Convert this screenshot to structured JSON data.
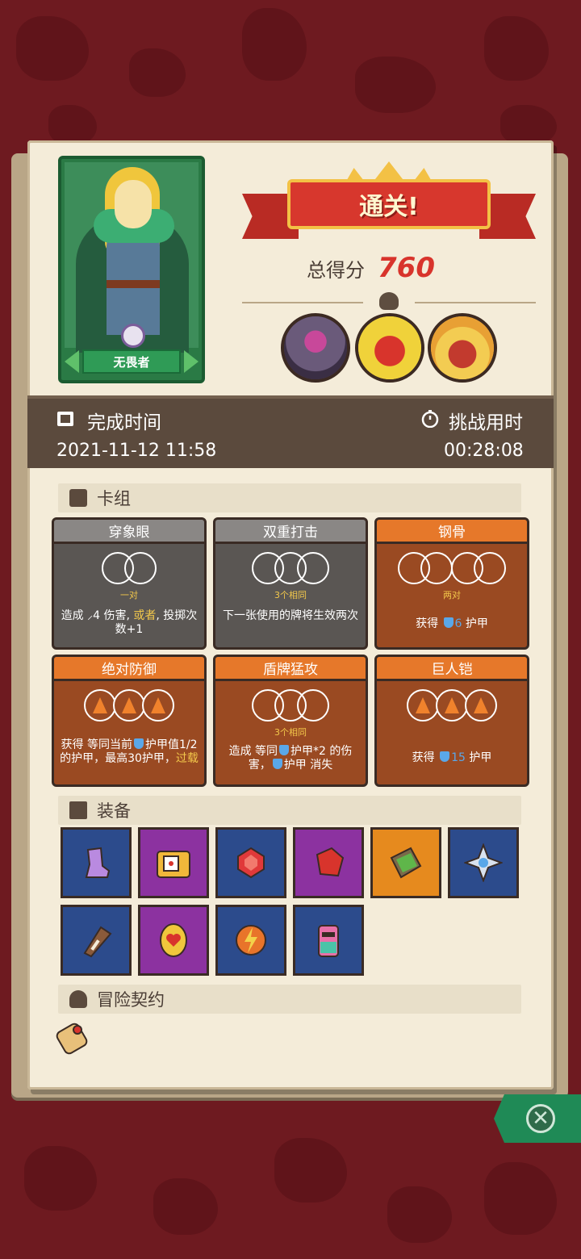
{
  "hero": {
    "name": "无畏者"
  },
  "banner": {
    "title": "通关!"
  },
  "score": {
    "label": "总得分",
    "value": "760"
  },
  "time": {
    "finish_label": "完成时间",
    "finish_value": "2021-11-12 11:58",
    "duration_label": "挑战用时",
    "duration_value": "00:28:08"
  },
  "sections": {
    "deck": "卡组",
    "equipment": "装备",
    "contract": "冒险契约"
  },
  "skills": [
    {
      "name": "穿象眼",
      "dice_label": "一对",
      "desc_a": "造成 ",
      "desc_b": "4 伤害, ",
      "desc_hl": "或者",
      "desc_c": ", 投掷次数+1"
    },
    {
      "name": "双重打击",
      "dice_label": "3个相同",
      "desc": "下一张使用的牌将生效两次"
    },
    {
      "name": "钢骨",
      "dice_label": "两对",
      "desc_a": "获得 ",
      "desc_value": "6",
      "desc_b": " 护甲"
    },
    {
      "name": "绝对防御",
      "desc_a": "获得 等同当前",
      "desc_b": "护甲值1/2的护甲，最高30护甲，",
      "desc_hl": "过载"
    },
    {
      "name": "盾牌猛攻",
      "dice_label": "3个相同",
      "desc_a": "造成 等同",
      "desc_b": "护甲*2 的伤害，",
      "desc_c": "护甲 消失"
    },
    {
      "name": "巨人铠",
      "desc_a": "获得 ",
      "desc_value": "15",
      "desc_b": " 护甲"
    }
  ],
  "equipment": [
    {
      "icon": "crystal-boot-icon",
      "bg": "#2c4b8c"
    },
    {
      "icon": "dice-chest-icon",
      "bg": "#8c32a0"
    },
    {
      "icon": "red-gem-icon",
      "bg": "#2c4b8c"
    },
    {
      "icon": "ruby-icon",
      "bg": "#8c32a0"
    },
    {
      "icon": "moss-stone-icon",
      "bg": "#e68a1e"
    },
    {
      "icon": "silver-cross-icon",
      "bg": "#2c4b8c"
    },
    {
      "icon": "horn-icon",
      "bg": "#2c4b8c"
    },
    {
      "icon": "heart-rune-icon",
      "bg": "#8c32a0"
    },
    {
      "icon": "lightning-orb-icon",
      "bg": "#2c4b8c"
    },
    {
      "icon": "totem-icon",
      "bg": "#2c4b8c"
    }
  ],
  "colors": {
    "accent_red": "#d8342c",
    "card_bg": "#f4ecd9",
    "time_bar": "#5b4a3d"
  }
}
